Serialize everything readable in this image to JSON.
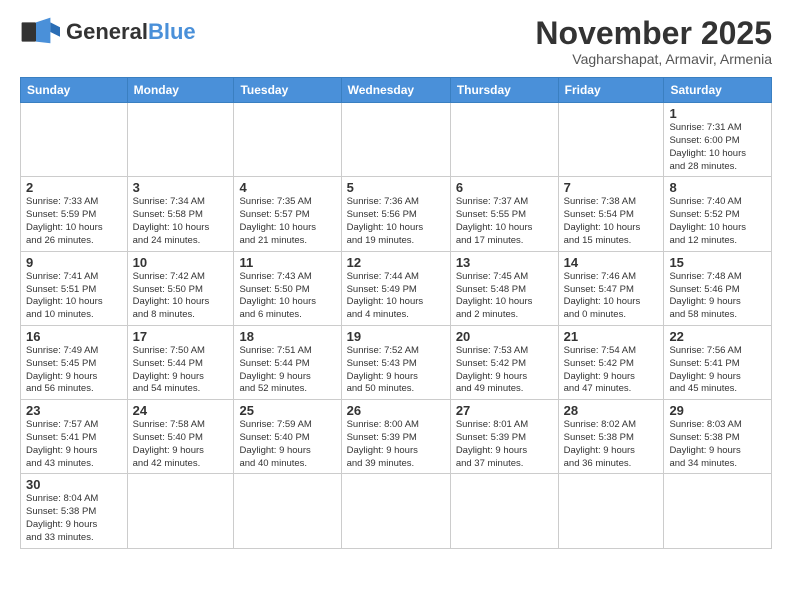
{
  "logo": {
    "general": "General",
    "blue": "Blue"
  },
  "header": {
    "month": "November 2025",
    "location": "Vagharshapat, Armavir, Armenia"
  },
  "days_of_week": [
    "Sunday",
    "Monday",
    "Tuesday",
    "Wednesday",
    "Thursday",
    "Friday",
    "Saturday"
  ],
  "weeks": [
    [
      {
        "day": "",
        "info": ""
      },
      {
        "day": "",
        "info": ""
      },
      {
        "day": "",
        "info": ""
      },
      {
        "day": "",
        "info": ""
      },
      {
        "day": "",
        "info": ""
      },
      {
        "day": "",
        "info": ""
      },
      {
        "day": "1",
        "info": "Sunrise: 7:31 AM\nSunset: 6:00 PM\nDaylight: 10 hours\nand 28 minutes."
      }
    ],
    [
      {
        "day": "2",
        "info": "Sunrise: 7:33 AM\nSunset: 5:59 PM\nDaylight: 10 hours\nand 26 minutes."
      },
      {
        "day": "3",
        "info": "Sunrise: 7:34 AM\nSunset: 5:58 PM\nDaylight: 10 hours\nand 24 minutes."
      },
      {
        "day": "4",
        "info": "Sunrise: 7:35 AM\nSunset: 5:57 PM\nDaylight: 10 hours\nand 21 minutes."
      },
      {
        "day": "5",
        "info": "Sunrise: 7:36 AM\nSunset: 5:56 PM\nDaylight: 10 hours\nand 19 minutes."
      },
      {
        "day": "6",
        "info": "Sunrise: 7:37 AM\nSunset: 5:55 PM\nDaylight: 10 hours\nand 17 minutes."
      },
      {
        "day": "7",
        "info": "Sunrise: 7:38 AM\nSunset: 5:54 PM\nDaylight: 10 hours\nand 15 minutes."
      },
      {
        "day": "8",
        "info": "Sunrise: 7:40 AM\nSunset: 5:52 PM\nDaylight: 10 hours\nand 12 minutes."
      }
    ],
    [
      {
        "day": "9",
        "info": "Sunrise: 7:41 AM\nSunset: 5:51 PM\nDaylight: 10 hours\nand 10 minutes."
      },
      {
        "day": "10",
        "info": "Sunrise: 7:42 AM\nSunset: 5:50 PM\nDaylight: 10 hours\nand 8 minutes."
      },
      {
        "day": "11",
        "info": "Sunrise: 7:43 AM\nSunset: 5:50 PM\nDaylight: 10 hours\nand 6 minutes."
      },
      {
        "day": "12",
        "info": "Sunrise: 7:44 AM\nSunset: 5:49 PM\nDaylight: 10 hours\nand 4 minutes."
      },
      {
        "day": "13",
        "info": "Sunrise: 7:45 AM\nSunset: 5:48 PM\nDaylight: 10 hours\nand 2 minutes."
      },
      {
        "day": "14",
        "info": "Sunrise: 7:46 AM\nSunset: 5:47 PM\nDaylight: 10 hours\nand 0 minutes."
      },
      {
        "day": "15",
        "info": "Sunrise: 7:48 AM\nSunset: 5:46 PM\nDaylight: 9 hours\nand 58 minutes."
      }
    ],
    [
      {
        "day": "16",
        "info": "Sunrise: 7:49 AM\nSunset: 5:45 PM\nDaylight: 9 hours\nand 56 minutes."
      },
      {
        "day": "17",
        "info": "Sunrise: 7:50 AM\nSunset: 5:44 PM\nDaylight: 9 hours\nand 54 minutes."
      },
      {
        "day": "18",
        "info": "Sunrise: 7:51 AM\nSunset: 5:44 PM\nDaylight: 9 hours\nand 52 minutes."
      },
      {
        "day": "19",
        "info": "Sunrise: 7:52 AM\nSunset: 5:43 PM\nDaylight: 9 hours\nand 50 minutes."
      },
      {
        "day": "20",
        "info": "Sunrise: 7:53 AM\nSunset: 5:42 PM\nDaylight: 9 hours\nand 49 minutes."
      },
      {
        "day": "21",
        "info": "Sunrise: 7:54 AM\nSunset: 5:42 PM\nDaylight: 9 hours\nand 47 minutes."
      },
      {
        "day": "22",
        "info": "Sunrise: 7:56 AM\nSunset: 5:41 PM\nDaylight: 9 hours\nand 45 minutes."
      }
    ],
    [
      {
        "day": "23",
        "info": "Sunrise: 7:57 AM\nSunset: 5:41 PM\nDaylight: 9 hours\nand 43 minutes."
      },
      {
        "day": "24",
        "info": "Sunrise: 7:58 AM\nSunset: 5:40 PM\nDaylight: 9 hours\nand 42 minutes."
      },
      {
        "day": "25",
        "info": "Sunrise: 7:59 AM\nSunset: 5:40 PM\nDaylight: 9 hours\nand 40 minutes."
      },
      {
        "day": "26",
        "info": "Sunrise: 8:00 AM\nSunset: 5:39 PM\nDaylight: 9 hours\nand 39 minutes."
      },
      {
        "day": "27",
        "info": "Sunrise: 8:01 AM\nSunset: 5:39 PM\nDaylight: 9 hours\nand 37 minutes."
      },
      {
        "day": "28",
        "info": "Sunrise: 8:02 AM\nSunset: 5:38 PM\nDaylight: 9 hours\nand 36 minutes."
      },
      {
        "day": "29",
        "info": "Sunrise: 8:03 AM\nSunset: 5:38 PM\nDaylight: 9 hours\nand 34 minutes."
      }
    ],
    [
      {
        "day": "30",
        "info": "Sunrise: 8:04 AM\nSunset: 5:38 PM\nDaylight: 9 hours\nand 33 minutes."
      },
      {
        "day": "",
        "info": ""
      },
      {
        "day": "",
        "info": ""
      },
      {
        "day": "",
        "info": ""
      },
      {
        "day": "",
        "info": ""
      },
      {
        "day": "",
        "info": ""
      },
      {
        "day": "",
        "info": ""
      }
    ]
  ]
}
